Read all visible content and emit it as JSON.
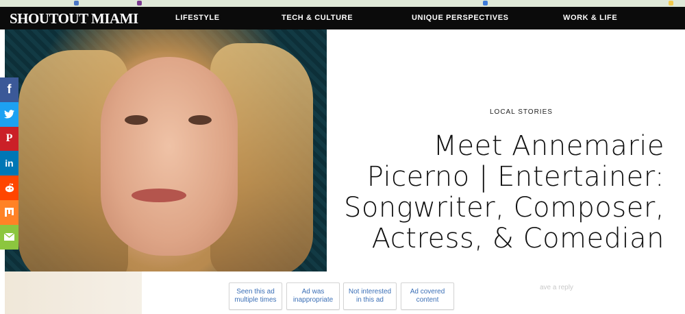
{
  "site": {
    "logo_text": "SHOUTOUT MIAMI"
  },
  "nav": {
    "items": [
      {
        "label": "LIFESTYLE"
      },
      {
        "label": "TECH & CULTURE"
      },
      {
        "label": "UNIQUE PERSPECTIVES"
      },
      {
        "label": "WORK & LIFE"
      }
    ]
  },
  "social": {
    "buttons": [
      {
        "network": "facebook",
        "glyph": "f",
        "color": "#3b5998"
      },
      {
        "network": "twitter",
        "glyph": "",
        "color": "#1da1f2"
      },
      {
        "network": "pinterest",
        "glyph": "P",
        "color": "#cb2027"
      },
      {
        "network": "linkedin",
        "glyph": "in",
        "color": "#0077b5"
      },
      {
        "network": "reddit",
        "glyph": "",
        "color": "#ff4500"
      },
      {
        "network": "mix",
        "glyph": "",
        "color": "#ff8226"
      },
      {
        "network": "email",
        "glyph": "",
        "color": "#8cc63f"
      }
    ]
  },
  "article": {
    "category": "LOCAL STORIES",
    "headline_lines": [
      "Meet Annemarie",
      "Picerno | Entertainer:",
      "Songwriter, Composer,",
      "Actress, & Comedian"
    ]
  },
  "ad_feedback": {
    "options": [
      {
        "label": "Seen this ad\nmultiple times"
      },
      {
        "label": "Ad was\ninappropriate"
      },
      {
        "label": "Not interested\nin this ad"
      },
      {
        "label": "Ad covered\ncontent"
      }
    ],
    "faded_text": "ave a reply"
  },
  "colors": {
    "nav_bg": "#0b0b0b",
    "ad_link": "#3b6fb6"
  }
}
